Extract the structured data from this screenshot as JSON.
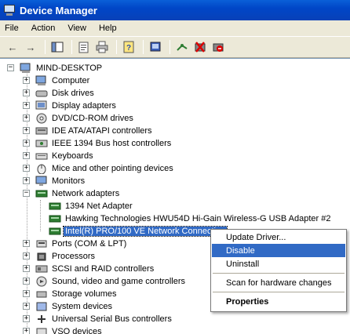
{
  "window": {
    "title": "Device Manager"
  },
  "menubar": {
    "items": [
      "File",
      "Action",
      "View",
      "Help"
    ]
  },
  "toolbar": {
    "buttons": [
      "back-icon",
      "forward-icon",
      "show-hide-console-tree-icon",
      "properties-icon",
      "print-icon",
      "help-icon",
      "refresh-icon",
      "scan-hardware-icon",
      "uninstall-icon",
      "disable-icon"
    ]
  },
  "tree": {
    "root": "MIND-DESKTOP",
    "categories": [
      "Computer",
      "Disk drives",
      "Display adapters",
      "DVD/CD-ROM drives",
      "IDE ATA/ATAPI controllers",
      "IEEE 1394 Bus host controllers",
      "Keyboards",
      "Mice and other pointing devices",
      "Monitors",
      "Network adapters"
    ],
    "network_children": [
      "1394 Net Adapter",
      "Hawking Technologies HWU54D Hi-Gain Wireless-G USB Adapter #2",
      "Intel(R) PRO/100 VE Network Connection"
    ],
    "categories_after": [
      "Ports (COM & LPT)",
      "Processors",
      "SCSI and RAID controllers",
      "Sound, video and game controllers",
      "Storage volumes",
      "System devices",
      "Universal Serial Bus controllers",
      "VSO devices"
    ]
  },
  "context_menu": {
    "update_driver": "Update Driver...",
    "disable": "Disable",
    "uninstall": "Uninstall",
    "scan": "Scan for hardware changes",
    "properties": "Properties"
  },
  "colors": {
    "title_bar": "#0046c7",
    "selection": "#316ac5",
    "chrome": "#ece9d8"
  }
}
